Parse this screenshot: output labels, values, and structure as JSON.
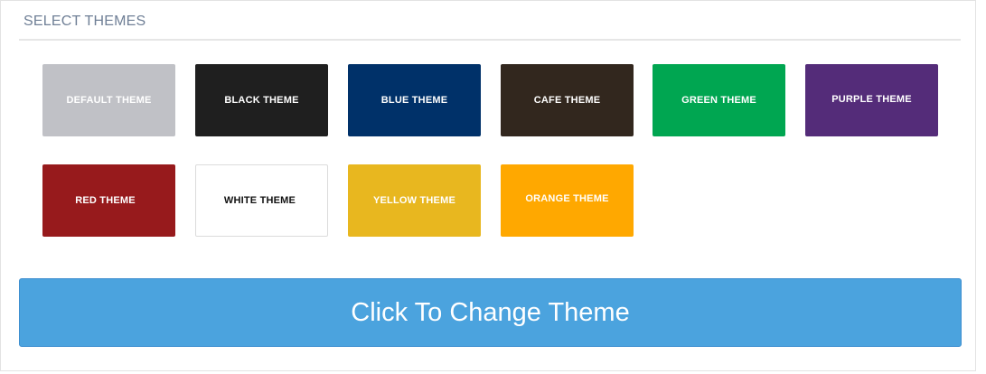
{
  "section": {
    "title": "SELECT THEMES"
  },
  "themes": [
    {
      "label": "DEFAULT THEME",
      "bg": "#c0c1c6",
      "fg": "#ffffff",
      "border": "#c0c1c6"
    },
    {
      "label": "BLACK THEME",
      "bg": "#1f1f1f",
      "fg": "#ffffff",
      "border": "#1f1f1f"
    },
    {
      "label": "BLUE THEME",
      "bg": "#003169",
      "fg": "#ffffff",
      "border": "#003169"
    },
    {
      "label": "CAFE THEME",
      "bg": "#32271e",
      "fg": "#ffffff",
      "border": "#32271e"
    },
    {
      "label": "GREEN THEME",
      "bg": "#00a651",
      "fg": "#ffffff",
      "border": "#00a651"
    },
    {
      "label": "PURPLE THEME",
      "bg": "#542c79",
      "fg": "#ffffff",
      "border": "#542c79"
    },
    {
      "label": "RED THEME",
      "bg": "#971a1c",
      "fg": "#ffffff",
      "border": "#971a1c"
    },
    {
      "label": "WHITE THEME",
      "bg": "#ffffff",
      "fg": "#111111",
      "border": "#dcdcdc"
    },
    {
      "label": "YELLOW THEME",
      "bg": "#e8b71f",
      "fg": "#ffffff",
      "border": "#e8b71f"
    },
    {
      "label": "ORANGE THEME",
      "bg": "#ffa800",
      "fg": "#ffffff",
      "border": "#ffa800"
    }
  ],
  "action": {
    "label": "Click To Change Theme",
    "bg": "#4ba3de"
  }
}
